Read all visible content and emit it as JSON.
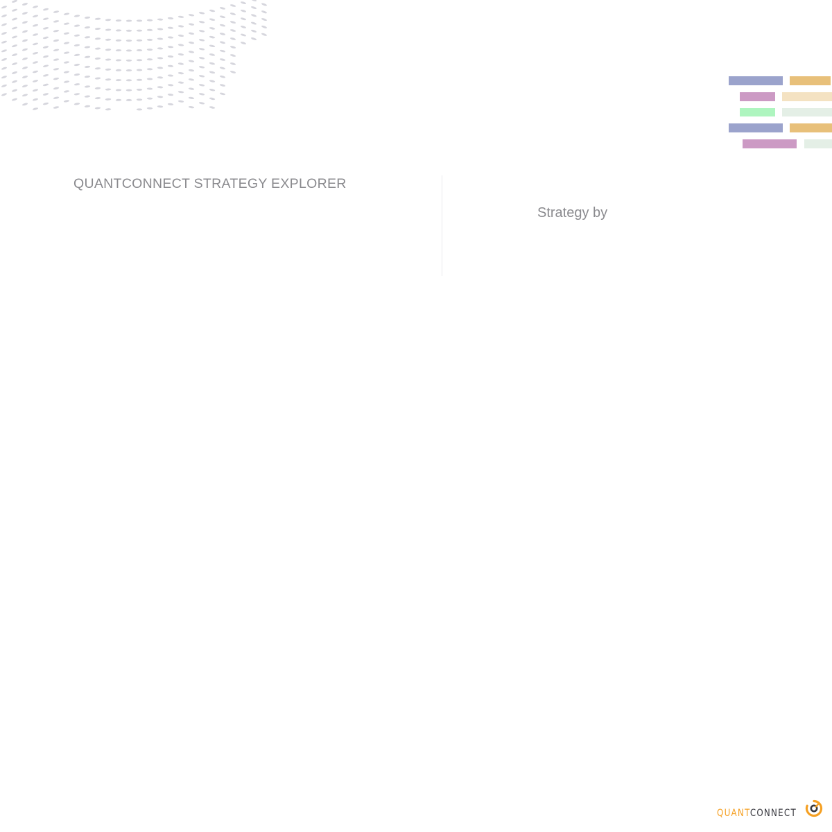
{
  "header": {
    "eyebrow": "QUANTCONNECT STRATEGY EXPLORER",
    "byline": "Strategy by"
  },
  "logo": {
    "part1": "QUANT",
    "part2": "CONNECT",
    "icon": "quantconnect-logo-mark"
  },
  "colors": {
    "text_muted": "#8a8a8e",
    "divider": "#e9e9ec",
    "logo_orange": "#f5a023",
    "logo_dark": "#3a3a40",
    "wave_dots": "#d6d6dd",
    "bar_blue": "#9ba3cc",
    "bar_orange": "#e8c07a",
    "bar_pink": "#cc9ac4",
    "bar_green": "#aef5bf",
    "bar_orange_light": "#f4e2c2",
    "bar_green_light": "#e4efe6"
  },
  "decor": {
    "wave_icon": "dotted-wave-graphic",
    "bars_icon": "colored-bars-graphic"
  }
}
